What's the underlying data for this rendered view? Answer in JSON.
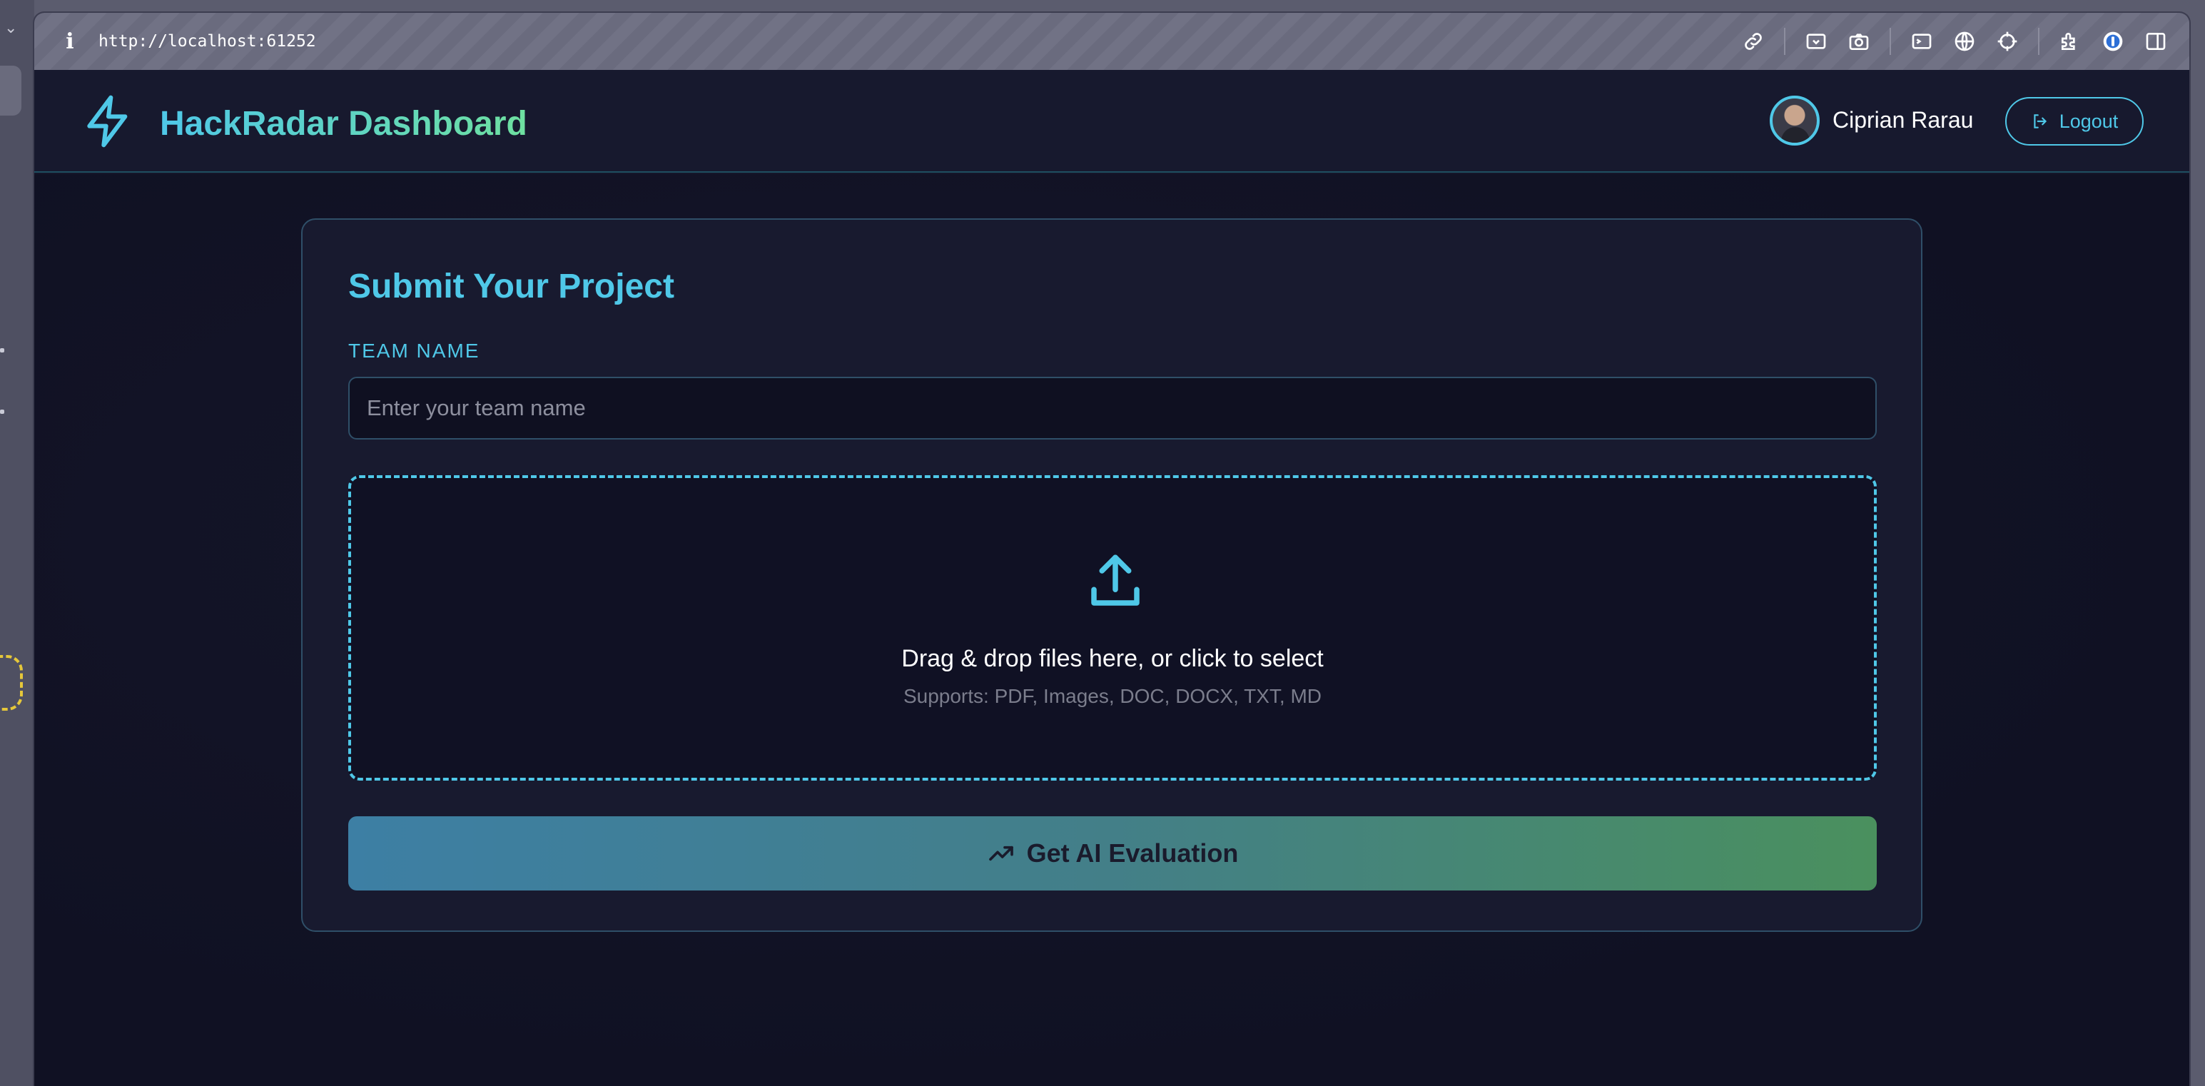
{
  "browser": {
    "url": "http://localhost:61252",
    "tool_icons": [
      "link-icon",
      "screenshot-area-icon",
      "camera-icon",
      "terminal-icon",
      "globe-icon",
      "crosshair-icon",
      "extensions-icon",
      "password-manager-icon",
      "sidebar-icon"
    ]
  },
  "header": {
    "title": "HackRadar Dashboard",
    "user_name": "Ciprian Rarau",
    "logout_label": "Logout"
  },
  "form": {
    "title": "Submit Your Project",
    "team_label": "TEAM NAME",
    "team_placeholder": "Enter your team name",
    "team_value": "",
    "dropzone_text": "Drag & drop files here, or click to select",
    "dropzone_sub": "Supports: PDF, Images, DOC, DOCX, TXT, MD",
    "submit_label": "Get AI Evaluation"
  },
  "colors": {
    "accent": "#4fc8e8",
    "accent_green": "#6ee0a0",
    "background": "#15162a"
  }
}
